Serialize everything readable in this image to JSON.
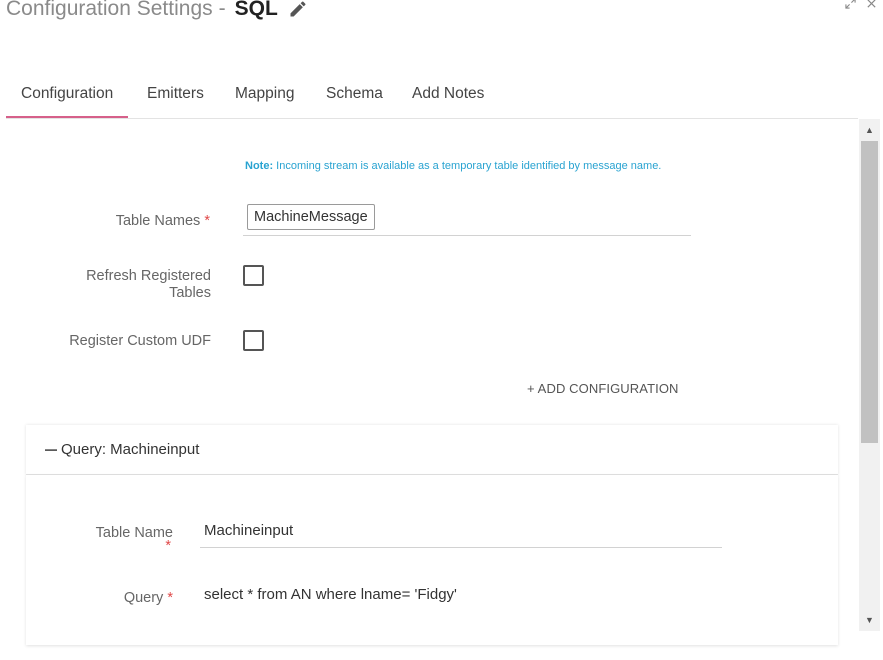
{
  "header": {
    "title": "Configuration Settings",
    "separator": "-",
    "component_name": "SQL",
    "edit_icon": "pencil-icon",
    "expand_icon": "expand-icon",
    "close_icon": "close-icon"
  },
  "tabs": [
    {
      "label": "Configuration",
      "active": true
    },
    {
      "label": "Emitters",
      "active": false
    },
    {
      "label": "Mapping",
      "active": false
    },
    {
      "label": "Schema",
      "active": false
    },
    {
      "label": "Add Notes",
      "active": false
    }
  ],
  "note": {
    "prefix": "Note:",
    "text": "Incoming stream is available as a temporary table identified by message name."
  },
  "form": {
    "table_names": {
      "label": "Table Names",
      "required": "*",
      "value": "MachineMessage"
    },
    "refresh_registered_tables": {
      "label_line1": "Refresh Registered",
      "label_line2": "Tables",
      "checked": false
    },
    "register_custom_udf": {
      "label": "Register Custom UDF",
      "checked": false
    }
  },
  "add_configuration": {
    "icon": "plus-icon",
    "label": "+ ADD CONFIGURATION"
  },
  "query_panel": {
    "collapse_icon": "minus-icon",
    "title": "Query: Machineinput",
    "table_name": {
      "label": "Table Name",
      "required": "*",
      "value": "Machineinput"
    },
    "query": {
      "label": "Query",
      "required": "*",
      "value": "select * from AN  where lname= 'Fidgy'"
    }
  },
  "colors": {
    "tab_indicator": "#d6608a",
    "note_text": "#29a3d1",
    "required_marker": "#e04848"
  }
}
